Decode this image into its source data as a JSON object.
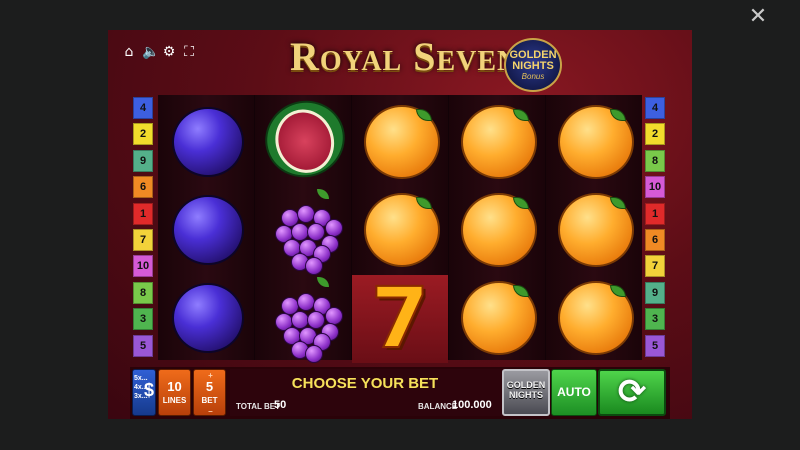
{
  "window": {
    "close_icon": "close-icon"
  },
  "top_icons": [
    "home-icon",
    "sound-icon",
    "settings-icon",
    "fullscreen-icon"
  ],
  "game": {
    "title": "Royal Seven",
    "logo": {
      "line1": "GOLDEN",
      "line2": "NIGHTS",
      "line3": "Bonus"
    }
  },
  "paylines": {
    "left": [
      "4",
      "2",
      "9",
      "6",
      "1",
      "7",
      "10",
      "8",
      "3",
      "5"
    ],
    "right": [
      "4",
      "2",
      "8",
      "10",
      "1",
      "6",
      "7",
      "9",
      "3",
      "5"
    ],
    "colors": {
      "1": "#e02a2a",
      "2": "#f2dc2c",
      "3": "#4fb54f",
      "4": "#3d5fe0",
      "5": "#9a57d6",
      "6": "#f08a24",
      "7": "#f2d23a",
      "8": "#79c94a",
      "9": "#54b08a",
      "10": "#d65ad6"
    }
  },
  "reels": [
    [
      "plum",
      "plum",
      "plum"
    ],
    [
      "watermelon",
      "grapes",
      "grapes"
    ],
    [
      "orange",
      "orange",
      "seven"
    ],
    [
      "orange",
      "orange",
      "orange"
    ],
    [
      "orange",
      "orange",
      "orange"
    ]
  ],
  "controls": {
    "paytable": {
      "multipliers": [
        "5x...",
        "4x...",
        "3x..."
      ],
      "icon": "$"
    },
    "lines": {
      "value": "10",
      "label": "LINES"
    },
    "bet": {
      "value": "5",
      "label": "BET",
      "plus": "+",
      "minus": "–"
    },
    "message": "CHOOSE YOUR BET",
    "total_bet": {
      "label": "TOTAL BET",
      "value": "50"
    },
    "balance": {
      "label": "BALANCE",
      "value": "100.000"
    },
    "golden_nights": {
      "line1": "GOLDEN",
      "line2": "NIGHTS"
    },
    "auto": "AUTO",
    "spin_icon": "spin-arrows-icon"
  }
}
